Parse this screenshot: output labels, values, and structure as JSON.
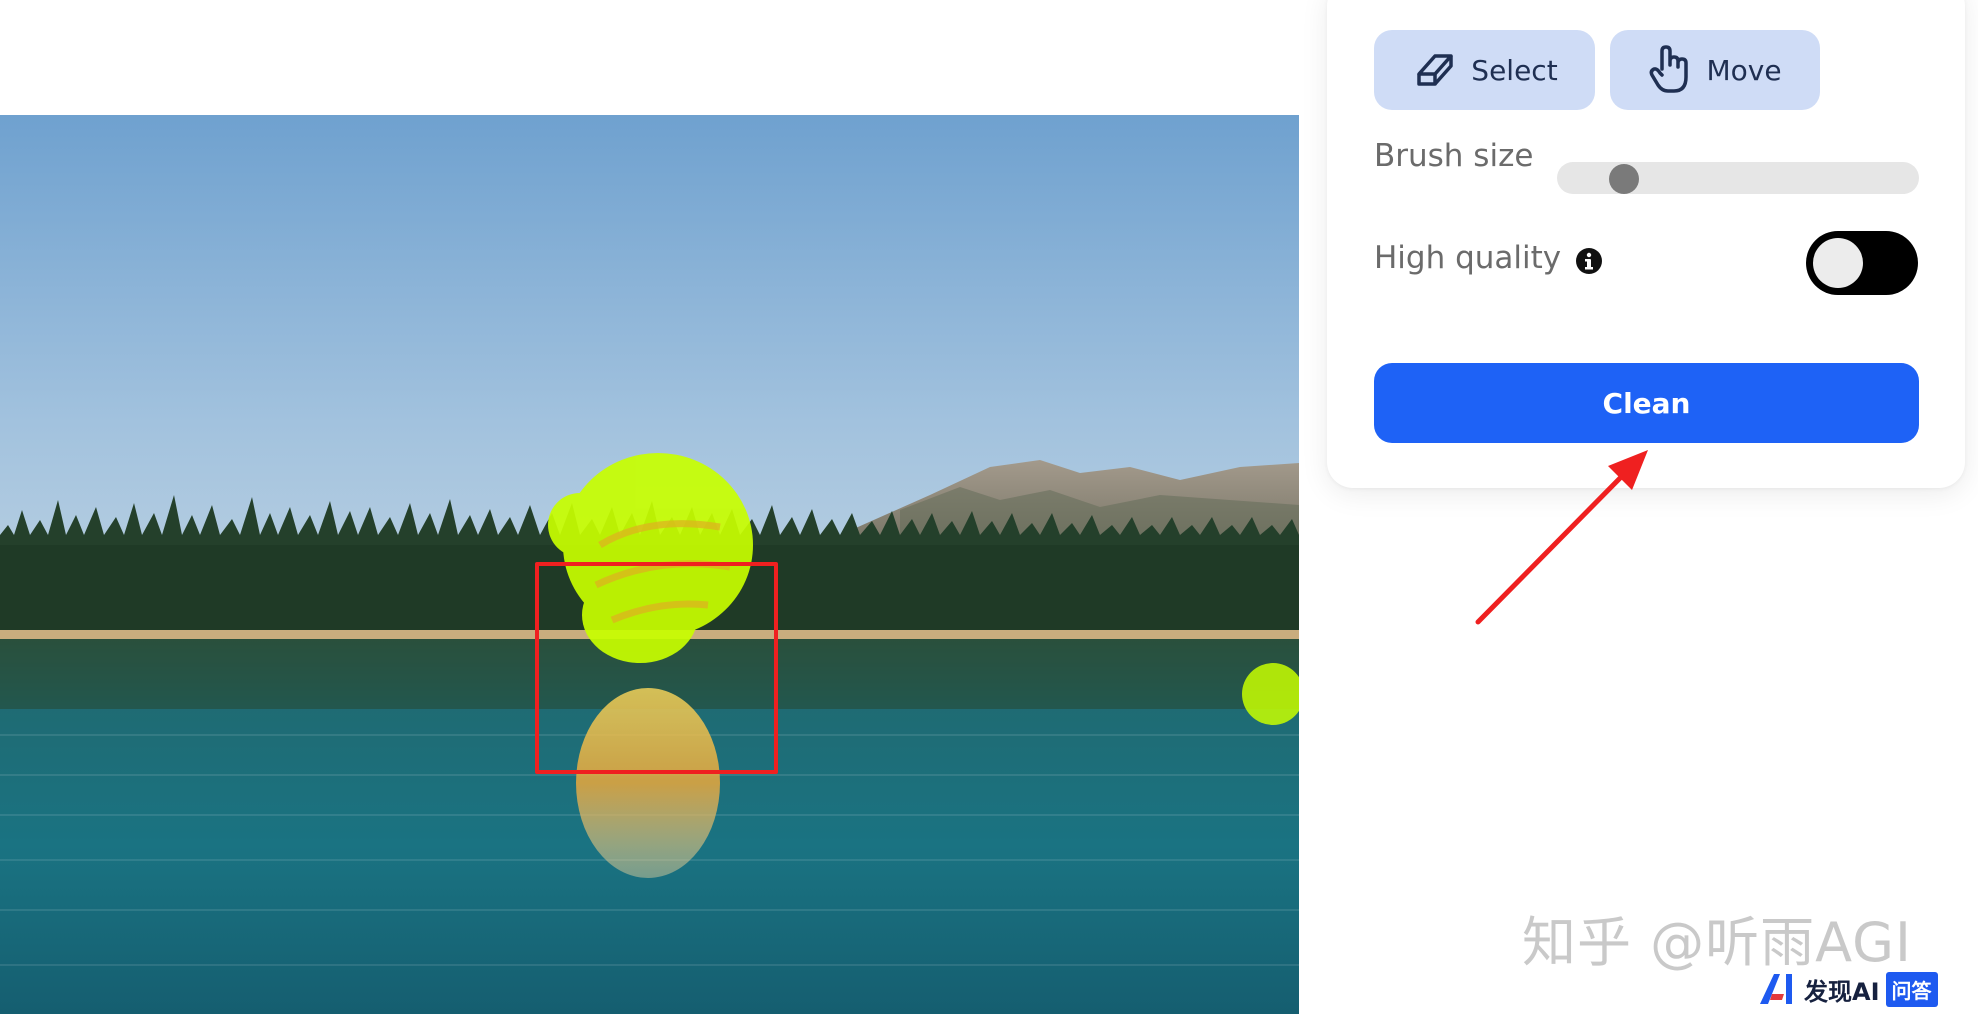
{
  "toolbar": {
    "select_label": "Select",
    "move_label": "Move",
    "select_icon": "eraser-icon",
    "move_icon": "hand-pointer-icon"
  },
  "settings": {
    "brush_size_label": "Brush size",
    "brush_size_level": 0.05,
    "high_quality_label": "High quality",
    "high_quality_enabled": false,
    "info_icon": "info-icon"
  },
  "actions": {
    "clean_label": "Clean"
  },
  "colors": {
    "accent": "#1e62f6",
    "tool_button_bg": "#cfdcf6",
    "selection_box": "#ef2020",
    "mask": "#c8ff00",
    "annotation_arrow": "#ef2020"
  },
  "watermark": {
    "text": "知乎 @听雨AGI"
  },
  "corner_logo": {
    "text": "发现AI",
    "badge": "问答"
  }
}
